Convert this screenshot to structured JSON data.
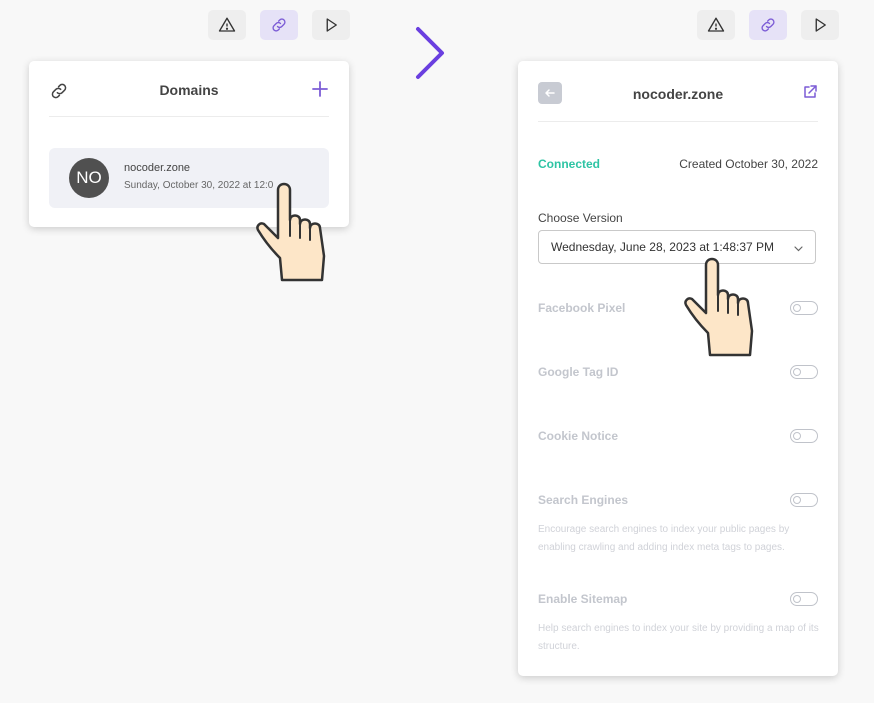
{
  "toolbar_icons": [
    "warning-icon",
    "link-icon",
    "play-icon"
  ],
  "colors": {
    "accent": "#7c5cd6",
    "connected": "#2ec4a4",
    "avatar_bg": "#505050"
  },
  "left_panel": {
    "title": "Domains",
    "domain": {
      "avatar_initials": "NO",
      "name": "nocoder.zone",
      "date": "Sunday, October 30, 2022 at 12:0"
    }
  },
  "right_panel": {
    "title": "nocoder.zone",
    "status": "Connected",
    "created": "Created October 30, 2022",
    "choose_version_label": "Choose Version",
    "selected_version": "Wednesday, June 28, 2023 at 1:48:37 PM",
    "settings": [
      {
        "label": "Facebook Pixel",
        "enabled": false
      },
      {
        "label": "Google Tag ID",
        "enabled": false
      },
      {
        "label": "Cookie Notice",
        "enabled": false
      },
      {
        "label": "Search Engines",
        "enabled": false,
        "description": "Encourage search engines to index your public pages by enabling crawling and adding index meta tags to pages."
      },
      {
        "label": "Enable Sitemap",
        "enabled": false,
        "description": "Help search engines to index your site by providing a map of its structure."
      }
    ]
  }
}
